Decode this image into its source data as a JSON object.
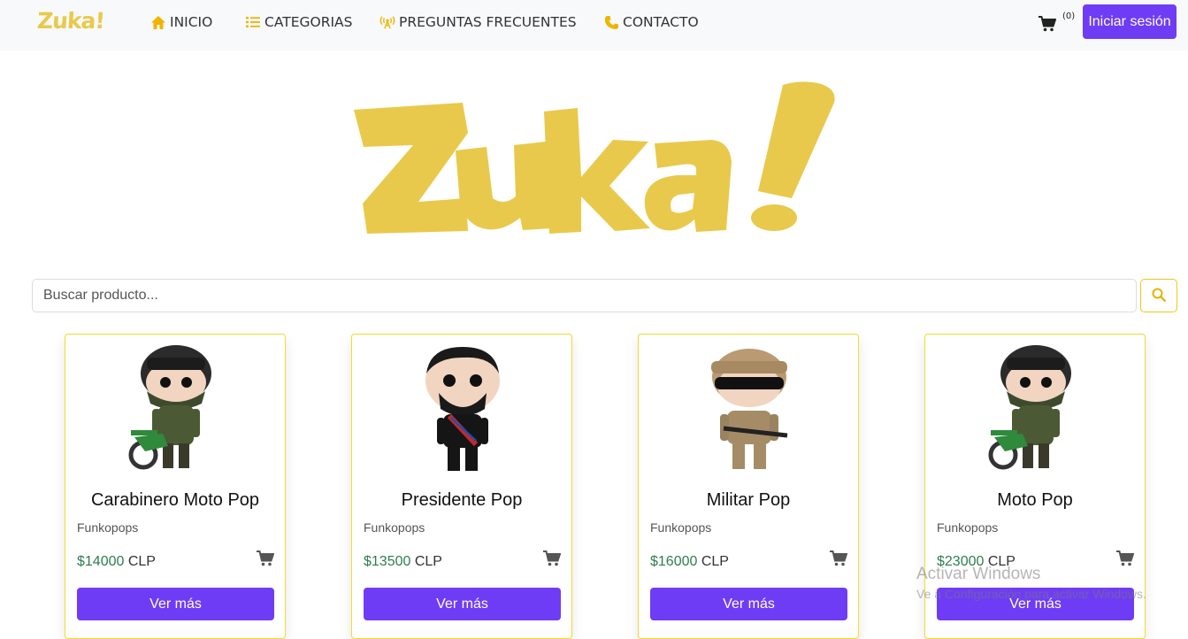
{
  "colors": {
    "brand_yellow": "#e9c94b",
    "accent_purple": "#6f3cf5",
    "price_green": "#2e7d4f",
    "nav_bg": "#f8f9fa",
    "card_border": "#f1dc2c"
  },
  "navbar": {
    "brand": "Zuka!",
    "items": [
      {
        "label": "INICIO",
        "icon": "home-icon"
      },
      {
        "label": "CATEGORIAS",
        "icon": "list-icon"
      },
      {
        "label": "PREGUNTAS FRECUENTES",
        "icon": "broadcast-icon"
      },
      {
        "label": "CONTACTO",
        "icon": "phone-icon"
      }
    ],
    "cart_count": "(0)",
    "login_label": "Iniciar sesión"
  },
  "hero": {
    "logo_text": "Zuka!"
  },
  "search": {
    "placeholder": "Buscar producto...",
    "value": ""
  },
  "products": [
    {
      "name": "Carabinero Moto Pop",
      "category": "Funkopops",
      "price": "$14000",
      "currency": "CLP",
      "button": "Ver más",
      "figure": "carabinero-moto"
    },
    {
      "name": "Presidente Pop",
      "category": "Funkopops",
      "price": "$13500",
      "currency": "CLP",
      "button": "Ver más",
      "figure": "presidente"
    },
    {
      "name": "Militar Pop",
      "category": "Funkopops",
      "price": "$16000",
      "currency": "CLP",
      "button": "Ver más",
      "figure": "militar"
    },
    {
      "name": "Moto Pop",
      "category": "Funkopops",
      "price": "$23000",
      "currency": "CLP",
      "button": "Ver más",
      "figure": "carabinero-moto"
    }
  ],
  "watermark": {
    "title": "Activar Windows",
    "subtitle": "Ve a Configuración para activar Windows."
  }
}
